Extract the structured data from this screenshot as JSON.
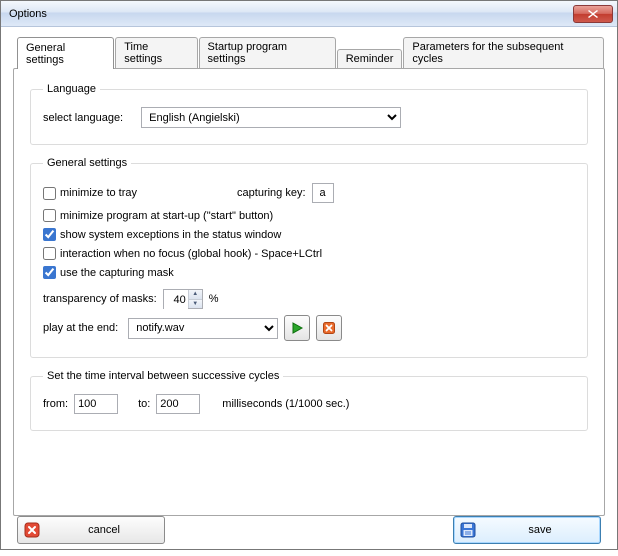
{
  "window": {
    "title": "Options"
  },
  "tabs": {
    "general": "General settings",
    "time": "Time settings",
    "startup": "Startup program settings",
    "reminder": "Reminder",
    "params": "Parameters for the subsequent cycles"
  },
  "language_group": {
    "legend": "Language",
    "select_label": "select language:",
    "value": "English (Angielski)"
  },
  "general_group": {
    "legend": "General settings",
    "minimize_tray": {
      "label": "minimize to tray",
      "checked": false
    },
    "capturing_key_label": "capturing key:",
    "capturing_key_value": "a",
    "minimize_startup": {
      "label": "minimize program at start-up (\"start\" button)",
      "checked": false
    },
    "show_exceptions": {
      "label": "show system exceptions in the status window",
      "checked": true
    },
    "global_hook": {
      "label": "interaction when no focus (global hook) - Space+LCtrl",
      "checked": false
    },
    "use_mask": {
      "label": "use the capturing mask",
      "checked": true
    },
    "transparency_label": "transparency of masks:",
    "transparency_value": "40",
    "transparency_unit": "%",
    "play_end_label": "play at the end:",
    "play_end_value": "notify.wav"
  },
  "interval_group": {
    "legend": "Set the time interval between successive cycles",
    "from_label": "from:",
    "from_value": "100",
    "to_label": "to:",
    "to_value": "200",
    "unit": "milliseconds (1/1000 sec.)"
  },
  "buttons": {
    "cancel": "cancel",
    "save": "save"
  }
}
